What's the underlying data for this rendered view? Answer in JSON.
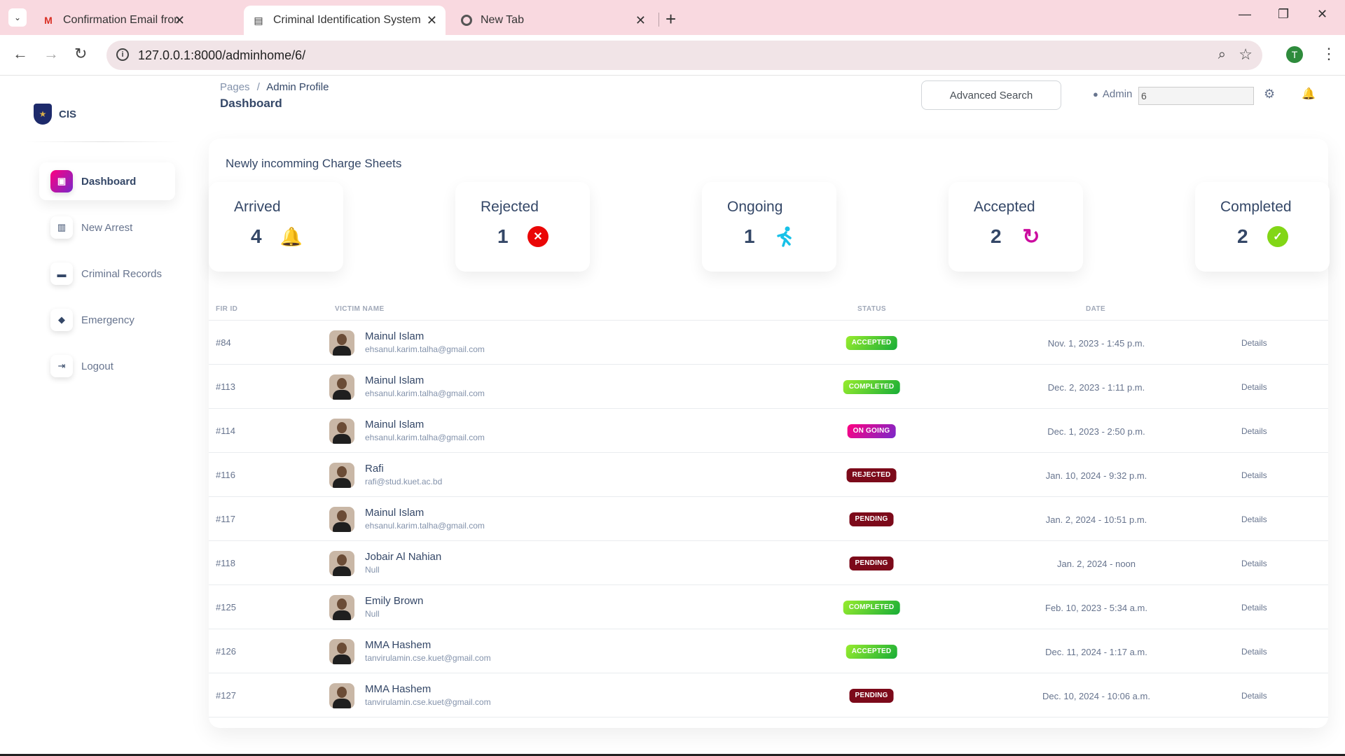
{
  "browser": {
    "tabs": [
      {
        "title": "Confirmation Email from CIS - t",
        "icon": "gmail-icon",
        "active": false
      },
      {
        "title": "Criminal Identification System -",
        "icon": "page-icon",
        "active": true
      },
      {
        "title": "New Tab",
        "icon": "chrome-icon",
        "active": false
      }
    ],
    "url": "127.0.0.1:8000/adminhome/6/",
    "profile_initial": "T"
  },
  "brand": {
    "name": "CIS"
  },
  "sidebar": {
    "items": [
      {
        "label": "Dashboard",
        "icon": "shop-icon",
        "active": true
      },
      {
        "label": "New Arrest",
        "icon": "building-icon",
        "active": false
      },
      {
        "label": "Criminal Records",
        "icon": "card-icon",
        "active": false
      },
      {
        "label": "Emergency",
        "icon": "box-icon",
        "active": false
      },
      {
        "label": "Logout",
        "icon": "logout-icon",
        "active": false
      }
    ]
  },
  "header": {
    "breadcrumb_root": "Pages",
    "breadcrumb_sep": "/",
    "breadcrumb_current": "Admin Profile",
    "title": "Dashboard",
    "advanced_search_label": "Advanced Search",
    "admin_label": "Admin",
    "admin_value": "6"
  },
  "main": {
    "section_title": "Newly incomming Charge Sheets",
    "stats": [
      {
        "label": "Arrived",
        "value": "4",
        "icon": "bell-icon",
        "color": "#fbcf33"
      },
      {
        "label": "Rejected",
        "value": "1",
        "icon": "x-circle-icon",
        "color": "#ea0606"
      },
      {
        "label": "Ongoing",
        "value": "1",
        "icon": "running-icon",
        "color": "#17c1e8"
      },
      {
        "label": "Accepted",
        "value": "2",
        "icon": "sync-icon",
        "color": "#cb0c9f"
      },
      {
        "label": "Completed",
        "value": "2",
        "icon": "check-circle-icon",
        "color": "#82d616"
      }
    ],
    "table": {
      "headers": {
        "fir": "FIR ID",
        "victim": "VICTIM NAME",
        "status": "STATUS",
        "date": "DATE"
      },
      "details_label": "Details",
      "rows": [
        {
          "fir": "#84",
          "name": "Mainul Islam",
          "email": "ehsanul.karim.talha@gmail.com",
          "status": "ACCEPTED",
          "status_key": "accepted",
          "date": "Nov. 1, 2023 - 1:45 p.m."
        },
        {
          "fir": "#113",
          "name": "Mainul Islam",
          "email": "ehsanul.karim.talha@gmail.com",
          "status": "COMPLETED",
          "status_key": "completed",
          "date": "Dec. 2, 2023 - 1:11 p.m."
        },
        {
          "fir": "#114",
          "name": "Mainul Islam",
          "email": "ehsanul.karim.talha@gmail.com",
          "status": "ON GOING",
          "status_key": "ongoing",
          "date": "Dec. 1, 2023 - 2:50 p.m."
        },
        {
          "fir": "#116",
          "name": "Rafi",
          "email": "rafi@stud.kuet.ac.bd",
          "status": "REJECTED",
          "status_key": "rejected",
          "date": "Jan. 10, 2024 - 9:32 p.m."
        },
        {
          "fir": "#117",
          "name": "Mainul Islam",
          "email": "ehsanul.karim.talha@gmail.com",
          "status": "PENDING",
          "status_key": "pending",
          "date": "Jan. 2, 2024 - 10:51 p.m."
        },
        {
          "fir": "#118",
          "name": "Jobair Al Nahian",
          "email": "Null",
          "status": "PENDING",
          "status_key": "pending",
          "date": "Jan. 2, 2024 - noon"
        },
        {
          "fir": "#125",
          "name": "Emily Brown",
          "email": "Null",
          "status": "COMPLETED",
          "status_key": "completed",
          "date": "Feb. 10, 2023 - 5:34 a.m."
        },
        {
          "fir": "#126",
          "name": "MMA Hashem",
          "email": "tanvirulamin.cse.kuet@gmail.com",
          "status": "ACCEPTED",
          "status_key": "accepted",
          "date": "Dec. 11, 2024 - 1:17 a.m."
        },
        {
          "fir": "#127",
          "name": "MMA Hashem",
          "email": "tanvirulamin.cse.kuet@gmail.com",
          "status": "PENDING",
          "status_key": "pending",
          "date": "Dec. 10, 2024 - 10:06 a.m."
        }
      ]
    }
  }
}
